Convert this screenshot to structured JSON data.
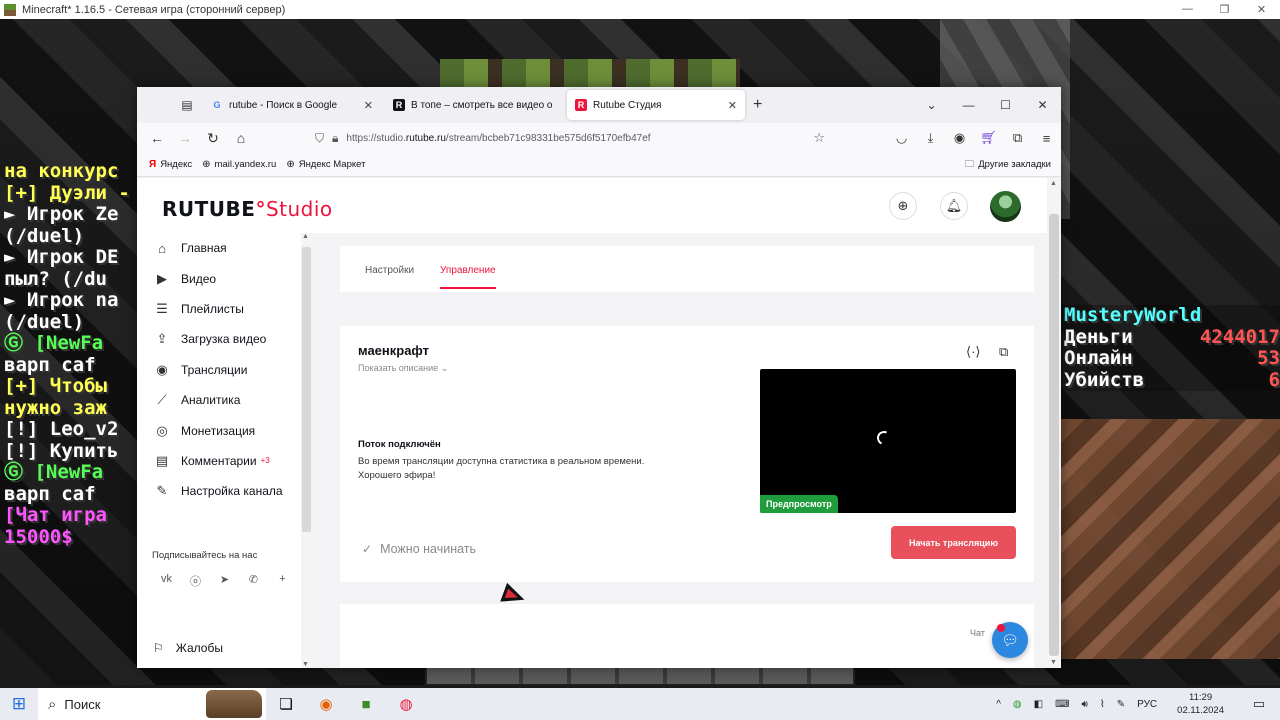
{
  "window": {
    "title": "Minecraft* 1.16.5 - Сетевая игра (сторонний сервер)"
  },
  "game": {
    "chat": [
      {
        "text": "на конкурс",
        "color": "yellow"
      },
      {
        "text": "[+] Дуэли -",
        "color": "yellow"
      },
      {
        "text": "► Игрок Ze",
        "color": "white"
      },
      {
        "text": "(/duel)",
        "color": "white"
      },
      {
        "text": "► Игрок DE",
        "color": "white"
      },
      {
        "text": "пыл? (/du",
        "color": "white"
      },
      {
        "text": "► Игрок na",
        "color": "white"
      },
      {
        "text": "(/duel)",
        "color": "white"
      },
      {
        "text": "Ⓖ [NewFa",
        "color": "green"
      },
      {
        "text": "варп caf",
        "color": "white"
      },
      {
        "text": "[+] Чтобы",
        "color": "yellow"
      },
      {
        "text": "нужно заж",
        "color": "yellow"
      },
      {
        "text": "[!] Leo_v2",
        "color": "white"
      },
      {
        "text": "[!] Купить",
        "color": "white"
      },
      {
        "text": "Ⓖ [NewFa",
        "color": "green"
      },
      {
        "text": "варп caf",
        "color": "white"
      },
      {
        "text": "[Чат игра",
        "color": "pink"
      },
      {
        "text": "15000$",
        "color": "pink"
      }
    ],
    "scoreboard": {
      "title": "MusteryWorld",
      "rows": [
        {
          "label": "Деньги",
          "value": "4244017"
        },
        {
          "label": "Онлайн",
          "value": "53"
        },
        {
          "label": "Убийств",
          "value": "6"
        }
      ]
    }
  },
  "browser": {
    "tabs": [
      {
        "label": "rutube - Поиск в Google",
        "favicon": "G"
      },
      {
        "label": "В топе – смотреть все видео о",
        "favicon": "R"
      },
      {
        "label": "Rutube Студия",
        "favicon": "R"
      }
    ],
    "url_prefix": "https://studio.",
    "url_domain": "rutube.ru",
    "url_path": "/stream/bcbeb71c98331be575d6f5170efb47ef",
    "bookmarks": [
      {
        "label": "Яндекс",
        "icon": "yandex-icon"
      },
      {
        "label": "mail.yandex.ru",
        "icon": "globe-icon"
      },
      {
        "label": "Яндекс Маркет",
        "icon": "globe-icon"
      }
    ],
    "other_bookmarks": "Другие закладки"
  },
  "studio": {
    "logo_main": "RUTUBE",
    "logo_studio": "Studio",
    "sidebar": {
      "items": [
        {
          "label": "Главная",
          "icon": "home-icon"
        },
        {
          "label": "Видео",
          "icon": "video-icon"
        },
        {
          "label": "Плейлисты",
          "icon": "playlist-icon"
        },
        {
          "label": "Загрузка видео",
          "icon": "upload-icon"
        },
        {
          "label": "Трансляции",
          "icon": "broadcast-icon"
        },
        {
          "label": "Аналитика",
          "icon": "analytics-icon"
        },
        {
          "label": "Монетизация",
          "icon": "monetization-icon"
        },
        {
          "label": "Комментарии",
          "icon": "comments-icon",
          "badge": "+3"
        },
        {
          "label": "Настройка канала",
          "icon": "channel-settings-icon"
        }
      ],
      "subscribe": "Подписывайтесь на нас",
      "complaints": "Жалобы"
    },
    "tabs": {
      "settings": "Настройки",
      "management": "Управление"
    },
    "stream": {
      "title": "маенкрафт",
      "show_description": "Показать описание",
      "status_title": "Поток подключён",
      "status_line1": "Во время трансляции доступна статистика в реальном времени.",
      "status_line2": "Хорошего эфира!",
      "preview_badge": "Предпросмотр",
      "ready": "Можно начинать",
      "start_button": "Начать трансляцию"
    },
    "chat_label": "Чат"
  },
  "taskbar": {
    "search": "Поиск",
    "lang": "РУС",
    "time": "11:29",
    "date": "02.11.2024"
  },
  "colors": {
    "brand": "#ed143b",
    "start_button": "#e8505b",
    "preview_badge": "#1f9d3c"
  }
}
